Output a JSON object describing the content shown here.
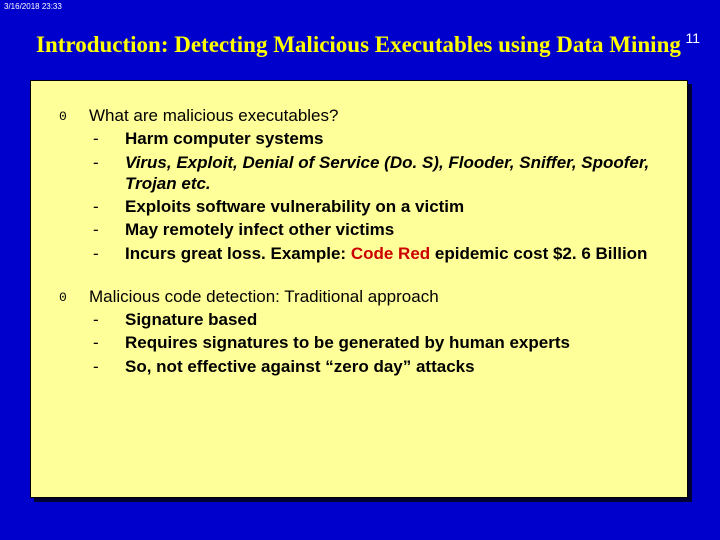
{
  "timestamp": "3/16/2018  23:33",
  "page_number": "11",
  "title": "Introduction: Detecting Malicious Executables using Data Mining",
  "topics": [
    {
      "question": "What are malicious executables?",
      "subs": [
        {
          "text": "Harm computer systems"
        },
        {
          "text_html": "<em>Virus, Exploit, Denial of Service (Do. S), Flooder, Sniffer, Spoofer, Trojan etc.</em>"
        },
        {
          "text": "Exploits software vulnerability on a victim"
        },
        {
          "text": "May remotely infect other victims"
        },
        {
          "text_html": "Incurs great loss. Example: <span class=\"code-red\">Code Red</span> epidemic cost $2. 6 Billion"
        }
      ]
    },
    {
      "question": "Malicious code detection: Traditional approach",
      "subs": [
        {
          "text": "Signature based"
        },
        {
          "text": "Requires signatures to be generated by human experts"
        },
        {
          "text": "So, not effective against “zero day” attacks"
        }
      ]
    }
  ]
}
